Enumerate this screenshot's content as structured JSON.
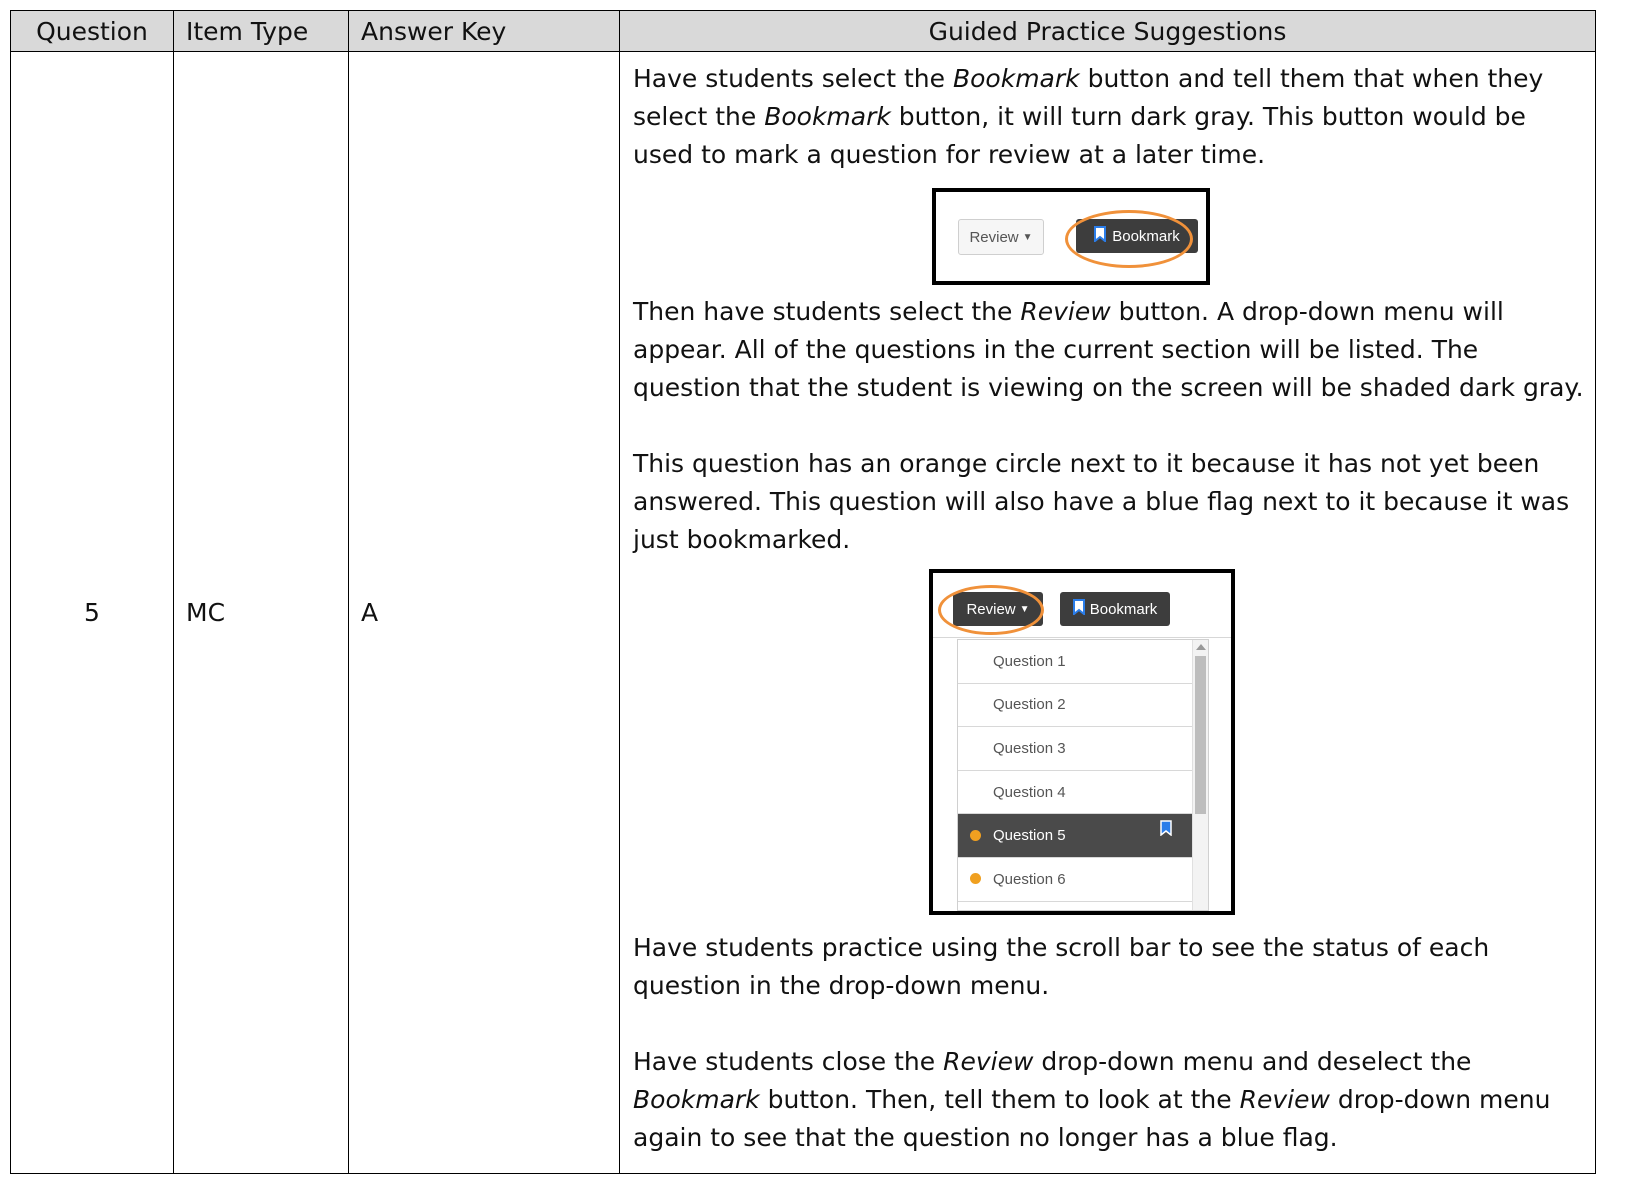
{
  "table": {
    "headers": {
      "question": "Question",
      "item_type": "Item Type",
      "answer_key": "Answer Key",
      "guided": "Guided Practice Suggestions"
    },
    "row": {
      "question": "5",
      "item_type": "MC",
      "answer_key": "A"
    }
  },
  "guided": {
    "p1_a": "Have students select the ",
    "p1_b": "Bookmark",
    "p1_c": " button and tell them that when they select the ",
    "p1_d": "Bookmark",
    "p1_e": " button, it will turn dark gray.  This button would be used to mark a question for review at a later time.",
    "p2_a": "Then have students select the ",
    "p2_b": "Review",
    "p2_c": " button.   A drop-down menu will appear.  All of the questions in the current section will be listed.  The question that the student is viewing on the screen will be shaded dark gray.",
    "p3": "This question has an orange circle next to it because it has not yet been answered.  This question will also have a blue flag next to it because it was just bookmarked.",
    "p4": "Have students practice using the scroll bar to see the status of each question in the drop-down menu.",
    "p5_a": "Have students close the ",
    "p5_b": "Review",
    "p5_c": " drop-down menu and deselect the ",
    "p5_d": "Bookmark",
    "p5_e": " button. Then, tell them to look at the ",
    "p5_f": "Review",
    "p5_g": " drop-down menu again to see that the question no longer has a blue flag."
  },
  "figure1": {
    "review_label": "Review",
    "bookmark_label": "Bookmark",
    "highlight_color": "#f0913a"
  },
  "figure2": {
    "review_label": "Review",
    "bookmark_label": "Bookmark",
    "menu_items": [
      {
        "label": "Question 1",
        "unanswered": false,
        "bookmarked": false,
        "current": false
      },
      {
        "label": "Question 2",
        "unanswered": false,
        "bookmarked": false,
        "current": false
      },
      {
        "label": "Question 3",
        "unanswered": false,
        "bookmarked": false,
        "current": false
      },
      {
        "label": "Question 4",
        "unanswered": false,
        "bookmarked": false,
        "current": false
      },
      {
        "label": "Question 5",
        "unanswered": true,
        "bookmarked": true,
        "current": true
      },
      {
        "label": "Question 6",
        "unanswered": true,
        "bookmarked": false,
        "current": false
      }
    ],
    "unanswered_color": "#f0a020",
    "flag_color": "#2b7de9"
  }
}
